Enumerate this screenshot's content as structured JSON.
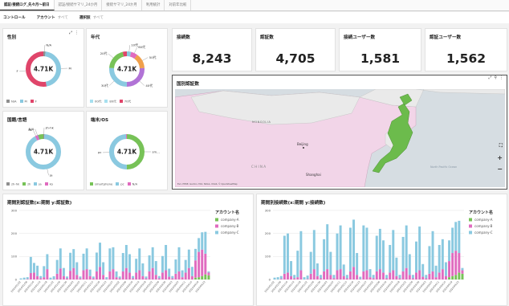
{
  "tabs": [
    {
      "label": "認証/接続ログ_先々月〜前日"
    },
    {
      "label": "認証/接続サマリ_24か月"
    },
    {
      "label": "接続サマリ_24か月"
    },
    {
      "label": "利用統計"
    },
    {
      "label": "対前年比較"
    }
  ],
  "controls": {
    "title": "コントロール",
    "account_label": "アカウント",
    "account_value": "すべて",
    "select_label": "選択肢",
    "select_value": "すべて"
  },
  "colors": {
    "blue": "#8ac9e0",
    "pink": "#e06bbf",
    "green": "#77c257",
    "red": "#e0456a",
    "gray": "#8f8f8f",
    "purple": "#b173d6",
    "orange": "#f0a04b",
    "lightblue": "#a7e0ef",
    "map_land": "#f2d5e8",
    "map_japan": "#6cbb4c"
  },
  "donuts": [
    {
      "title": "性別",
      "center": "4.71K",
      "segments": [
        {
          "label": "N/A",
          "value": 0.02,
          "color": "#8f8f8f"
        },
        {
          "label": "M",
          "value": 0.45,
          "color": "#8ac9e0"
        },
        {
          "label": "F",
          "value": 0.53,
          "color": "#e0456a"
        }
      ],
      "callouts": [
        "N/A",
        "M",
        "F"
      ],
      "legend": [
        "N/A",
        "M",
        "F"
      ]
    },
    {
      "title": "年代",
      "center": "4.71K",
      "segments": [
        {
          "label": "10代",
          "value": 0.04,
          "color": "#8ac9e0"
        },
        {
          "label": "60代",
          "value": 0.06,
          "color": "#e06bbf"
        },
        {
          "label": "50代",
          "value": 0.14,
          "color": "#f0a04b"
        },
        {
          "label": "40代",
          "value": 0.26,
          "color": "#b173d6"
        },
        {
          "label": "30代",
          "value": 0.26,
          "color": "#8ac9e0"
        },
        {
          "label": "20代",
          "value": 0.2,
          "color": "#77c257"
        },
        {
          "label": "70代",
          "value": 0.04,
          "color": "#e0456a"
        }
      ],
      "callouts": [
        "10代",
        "60代",
        "20代",
        "50代",
        "30代",
        "40代"
      ],
      "legend": [
        "00代",
        "80代",
        "70代"
      ]
    },
    {
      "title": "国籍/言語",
      "center": "4.71K",
      "segments": [
        {
          "label": "zh-hk",
          "value": 0.01,
          "color": "#8f8f8f"
        },
        {
          "label": "ja",
          "value": 0.91,
          "color": "#8ac9e0"
        },
        {
          "label": "ko",
          "value": 0.02,
          "color": "#e06bbf"
        },
        {
          "label": "N/A",
          "value": 0.01,
          "color": "#b173d6"
        },
        {
          "label": "zh",
          "value": 0.05,
          "color": "#77c257"
        }
      ],
      "callouts": [
        "zh-hk",
        "N/A",
        "ja",
        "ko"
      ],
      "legend": [
        "zh-hk",
        "zh",
        "ja",
        "ko"
      ]
    },
    {
      "title": "端末/OS",
      "center": "4.71K",
      "segments": [
        {
          "label": "smartphone",
          "value": 0.5,
          "color": "#77c257"
        },
        {
          "label": "pc",
          "value": 0.49,
          "color": "#8ac9e0"
        },
        {
          "label": "N/A",
          "value": 0.01,
          "color": "#e06bbf"
        }
      ],
      "callouts": [
        "sm...",
        "pc"
      ],
      "legend": [
        "smartphone",
        "pc",
        "N/A"
      ]
    }
  ],
  "kpis": [
    {
      "label": "接続数",
      "value": "8,243"
    },
    {
      "label": "認証数",
      "value": "4,705"
    },
    {
      "label": "接続ユーザー数",
      "value": "1,581"
    },
    {
      "label": "認証ユーザー数",
      "value": "1,562"
    }
  ],
  "map": {
    "title": "国別認証数",
    "labels": {
      "mongolia": "MONGOLIA",
      "china": "CHINA",
      "beijing": "Beijing",
      "shanghai": "Shanghai",
      "pacific": "North Pacific Ocean"
    },
    "attribution": "Esri, HERE, Garmin, FAO, NOAA, USGS, © OpenStreetMap",
    "controls": [
      "⛶",
      "+",
      "−"
    ],
    "toolbar": [
      "⤢",
      "⚲",
      "⋮"
    ]
  },
  "bar_titles": {
    "left": "期間別認証数(x:期間 y:認証数)",
    "right": "期間別接続数(x:期間 y:接続数)"
  },
  "chart_data": [
    {
      "type": "bar",
      "stacked": true,
      "title": "期間別認証数(x:期間 y:認証数)",
      "xlabel": "",
      "ylabel": "",
      "ylim": [
        0,
        300
      ],
      "yticks": [
        0,
        100,
        200,
        300
      ],
      "legend_title": "アカウント名",
      "legend_position": "top-right",
      "categories": [
        "2024/01/02",
        "2024/01/04",
        "2024/01/06",
        "2024/01/08",
        "2024/01/10",
        "2024/01/12",
        "2024/01/14",
        "2024/01/16",
        "2024/01/18",
        "2024/01/20",
        "2024/01/22",
        "2024/01/24",
        "2024/01/26",
        "2024/01/28",
        "2024/01/30",
        "2024/02/01",
        "2024/02/03",
        "2024/02/05",
        "2024/02/07",
        "2024/02/09",
        "2024/02/11",
        "2024/02/13",
        "2024/02/15",
        "2024/02/17",
        "2024/02/19",
        "2024/02/21",
        "2024/02/23",
        "2024/02/25",
        "2024/02/27",
        "2024/02/29",
        "2024/03/02",
        "2024/03/04",
        "2024/03/06",
        "2024/03/08",
        "2024/03/10",
        "2024/03/12",
        "2024/03/14",
        "2024/03/16",
        "2024/03/18",
        "2024/03/20",
        "2024/03/22",
        "2024/03/24",
        "2024/03/26",
        "2024/03/28",
        "2024/03/30",
        "2024/04/01",
        "2024/04/03",
        "2024/04/05",
        "2024/04/07",
        "2024/04/09",
        "2024/04/11",
        "2024/04/13",
        "2024/04/15",
        "2024/04/17",
        "2024/04/19",
        "2024/04/21",
        "2024/04/23",
        "2024/04/25"
      ],
      "series": [
        {
          "name": "company-A",
          "color": "#77c257",
          "values": [
            0,
            0,
            0,
            0,
            0,
            0,
            0,
            0,
            0,
            0,
            0,
            0,
            0,
            0,
            0,
            0,
            0,
            0,
            0,
            0,
            0,
            0,
            0,
            0,
            0,
            0,
            0,
            0,
            0,
            0,
            0,
            0,
            0,
            0,
            0,
            0,
            0,
            0,
            0,
            0,
            0,
            0,
            0,
            0,
            0,
            0,
            0,
            0,
            0,
            0,
            0,
            0,
            0,
            8,
            10,
            15,
            22,
            18
          ]
        },
        {
          "name": "company-B",
          "color": "#e06bbf",
          "values": [
            0,
            0,
            2,
            28,
            30,
            15,
            5,
            10,
            45,
            0,
            2,
            25,
            48,
            15,
            5,
            38,
            50,
            20,
            5,
            40,
            45,
            15,
            5,
            35,
            55,
            20,
            2,
            35,
            45,
            10,
            5,
            35,
            50,
            30,
            5,
            30,
            40,
            15,
            5,
            35,
            50,
            20,
            5,
            30,
            40,
            12,
            5,
            25,
            35,
            10,
            30,
            50,
            15,
            75,
            110,
            115,
            90,
            12
          ]
        },
        {
          "name": "company-C",
          "color": "#8ac9e0",
          "values": [
            5,
            8,
            8,
            70,
            42,
            45,
            10,
            48,
            65,
            8,
            12,
            60,
            87,
            35,
            8,
            78,
            82,
            55,
            8,
            72,
            90,
            28,
            8,
            82,
            105,
            55,
            8,
            100,
            95,
            25,
            8,
            80,
            100,
            80,
            10,
            60,
            95,
            55,
            8,
            70,
            90,
            60,
            10,
            72,
            110,
            35,
            10,
            62,
            105,
            30,
            55,
            80,
            40,
            50,
            60,
            75,
            95,
            5
          ]
        }
      ]
    },
    {
      "type": "bar",
      "stacked": true,
      "title": "期間別接続数(x:期間 y:接続数)",
      "xlabel": "",
      "ylabel": "",
      "ylim": [
        0,
        300
      ],
      "yticks": [
        0,
        100,
        200,
        300
      ],
      "legend_title": "アカウント名",
      "legend_position": "top-right",
      "categories": [
        "2024/01/02",
        "2024/01/04",
        "2024/01/06",
        "2024/01/08",
        "2024/01/10",
        "2024/01/12",
        "2024/01/14",
        "2024/01/16",
        "2024/01/18",
        "2024/01/20",
        "2024/01/22",
        "2024/01/24",
        "2024/01/26",
        "2024/01/28",
        "2024/01/30",
        "2024/02/01",
        "2024/02/03",
        "2024/02/05",
        "2024/02/07",
        "2024/02/09",
        "2024/02/11",
        "2024/02/13",
        "2024/02/15",
        "2024/02/17",
        "2024/02/19",
        "2024/02/21",
        "2024/02/23",
        "2024/02/25",
        "2024/02/27",
        "2024/02/29",
        "2024/03/02",
        "2024/03/04",
        "2024/03/06",
        "2024/03/08",
        "2024/03/10",
        "2024/03/12",
        "2024/03/14",
        "2024/03/16",
        "2024/03/18",
        "2024/03/20",
        "2024/03/22",
        "2024/03/24",
        "2024/03/26",
        "2024/03/28",
        "2024/03/30",
        "2024/04/01",
        "2024/04/03",
        "2024/04/05",
        "2024/04/07",
        "2024/04/09",
        "2024/04/11",
        "2024/04/13",
        "2024/04/15",
        "2024/04/17",
        "2024/04/19",
        "2024/04/21",
        "2024/04/23",
        "2024/04/25"
      ],
      "series": [
        {
          "name": "company-A",
          "color": "#77c257",
          "values": [
            0,
            0,
            0,
            0,
            0,
            0,
            0,
            0,
            0,
            0,
            0,
            0,
            0,
            0,
            0,
            0,
            0,
            0,
            0,
            0,
            0,
            0,
            0,
            0,
            0,
            0,
            0,
            0,
            0,
            0,
            0,
            0,
            0,
            0,
            0,
            0,
            0,
            0,
            0,
            0,
            0,
            0,
            0,
            0,
            0,
            0,
            0,
            0,
            0,
            0,
            0,
            0,
            0,
            10,
            15,
            20,
            30,
            25
          ]
        },
        {
          "name": "company-B",
          "color": "#e06bbf",
          "values": [
            0,
            0,
            3,
            25,
            30,
            15,
            5,
            10,
            40,
            0,
            2,
            25,
            45,
            15,
            5,
            35,
            45,
            20,
            5,
            40,
            45,
            15,
            5,
            35,
            55,
            20,
            2,
            35,
            40,
            10,
            5,
            35,
            45,
            30,
            5,
            30,
            40,
            15,
            5,
            35,
            50,
            20,
            5,
            30,
            40,
            12,
            5,
            25,
            35,
            10,
            30,
            45,
            15,
            70,
            100,
            105,
            85,
            15
          ]
        },
        {
          "name": "company-C",
          "color": "#8ac9e0",
          "values": [
            8,
            10,
            12,
            165,
            170,
            65,
            15,
            115,
            170,
            10,
            15,
            95,
            170,
            55,
            15,
            140,
            195,
            100,
            15,
            160,
            190,
            50,
            15,
            190,
            205,
            95,
            10,
            200,
            185,
            35,
            15,
            155,
            175,
            140,
            15,
            120,
            175,
            80,
            15,
            150,
            185,
            90,
            15,
            135,
            190,
            55,
            15,
            120,
            175,
            50,
            120,
            130,
            60,
            90,
            110,
            125,
            140,
            10
          ]
        }
      ]
    }
  ]
}
